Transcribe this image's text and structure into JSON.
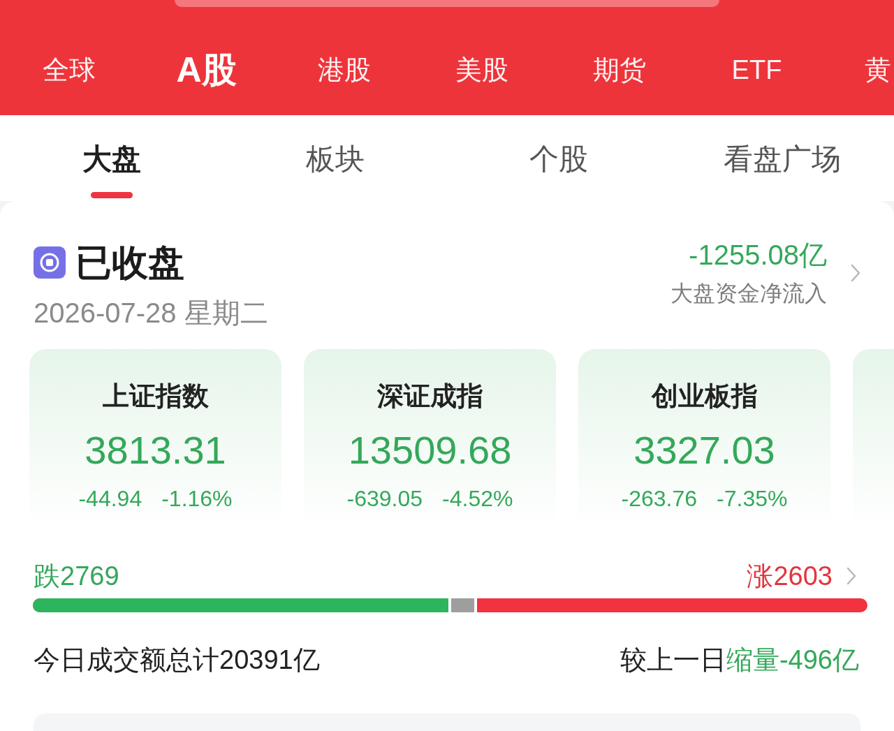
{
  "market_tabs": [
    {
      "label": "全球",
      "selected": false
    },
    {
      "label": "A股",
      "selected": true
    },
    {
      "label": "港股",
      "selected": false
    },
    {
      "label": "美股",
      "selected": false
    },
    {
      "label": "期货",
      "selected": false
    },
    {
      "label": "ETF",
      "selected": false
    },
    {
      "label": "黄",
      "selected": false
    }
  ],
  "sub_tabs": [
    {
      "label": "大盘",
      "selected": true
    },
    {
      "label": "板块",
      "selected": false
    },
    {
      "label": "个股",
      "selected": false
    },
    {
      "label": "看盘广场",
      "selected": false
    }
  ],
  "status": {
    "label": "已收盘",
    "date": "2026-07-28 星期二"
  },
  "net_inflow": {
    "value": "-1255.08亿",
    "label": "大盘资金净流入"
  },
  "index_cards": [
    {
      "name": "上证指数",
      "value": "3813.31",
      "change": "-44.94",
      "change_pct": "-1.16%"
    },
    {
      "name": "深证成指",
      "value": "13509.68",
      "change": "-639.05",
      "change_pct": "-4.52%"
    },
    {
      "name": "创业板指",
      "value": "3327.03",
      "change": "-263.76",
      "change_pct": "-7.35%"
    }
  ],
  "breadth": {
    "fall": "跌2769",
    "rise": "涨2603",
    "level": 0.498
  },
  "turnover": {
    "text": "今日成交额总计20391亿",
    "compare_label": "较上一日",
    "compare_value": "缩量-496亿"
  }
}
